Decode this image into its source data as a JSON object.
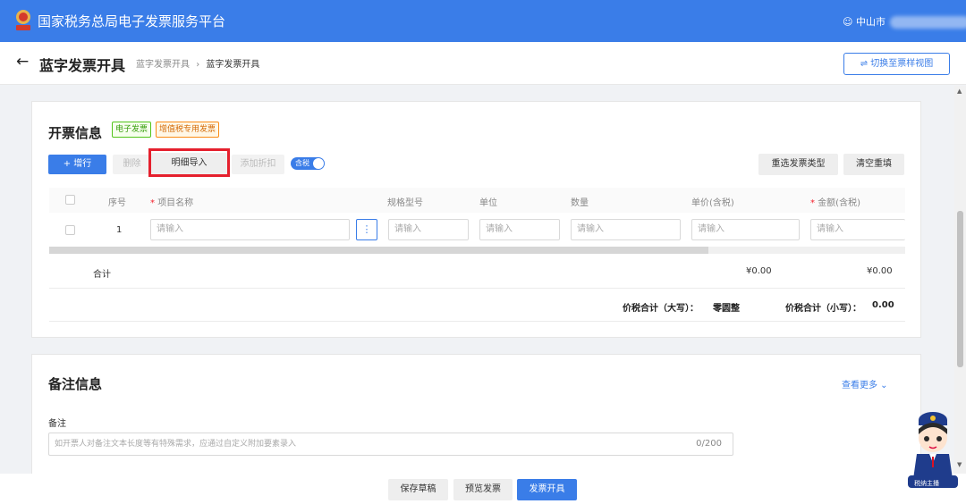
{
  "header": {
    "app_title": "国家税务总局电子发票服务平台",
    "user_label": "中山市"
  },
  "subheader": {
    "back": "←",
    "title": "蓝字发票开具",
    "breadcrumb_parent": "蓝字发票开具",
    "breadcrumb_sep": "›",
    "breadcrumb_current": "蓝字发票开具",
    "switch_label": "切换至票样视图",
    "switch_icon": "⇌"
  },
  "invoice_info": {
    "title": "开票信息",
    "tags": [
      "电子发票",
      "增值税专用发票"
    ],
    "toolbar": {
      "add_row": "+ 增行",
      "delete": "删除",
      "import_details": "明细导入",
      "add_discount": "添加折扣",
      "tax_included": "含税",
      "reselect_type": "重选发票类型",
      "clear_refill": "清空重填"
    },
    "columns": [
      "序号",
      "项目名称",
      "规格型号",
      "单位",
      "数量",
      "单价(含税)",
      "金额(含税)"
    ],
    "required_mark": "*",
    "row": {
      "index": "1",
      "placeholder": "请输入",
      "more": "⋮"
    },
    "total_label": "合计",
    "total_unit_price": "¥0.00",
    "total_amount": "¥0.00",
    "sum_upper_label": "价税合计（大写）：",
    "sum_upper_value": "零圆整",
    "sum_lower_label": "价税合计（小写）：",
    "sum_lower_value": "0.00"
  },
  "remarks": {
    "title": "备注信息",
    "view_more": "查看更多 ⌄",
    "label": "备注",
    "placeholder": "如开票人对备注文本长度等有特殊需求，应通过自定义附加要素录入",
    "counter": "0/200"
  },
  "footer": {
    "save_draft": "保存草稿",
    "preview": "预览发票",
    "issue": "发票开具"
  },
  "mascot_badge": "税纳主播",
  "colors": {
    "primary": "#3a7de8",
    "highlight": "#e5202d"
  }
}
